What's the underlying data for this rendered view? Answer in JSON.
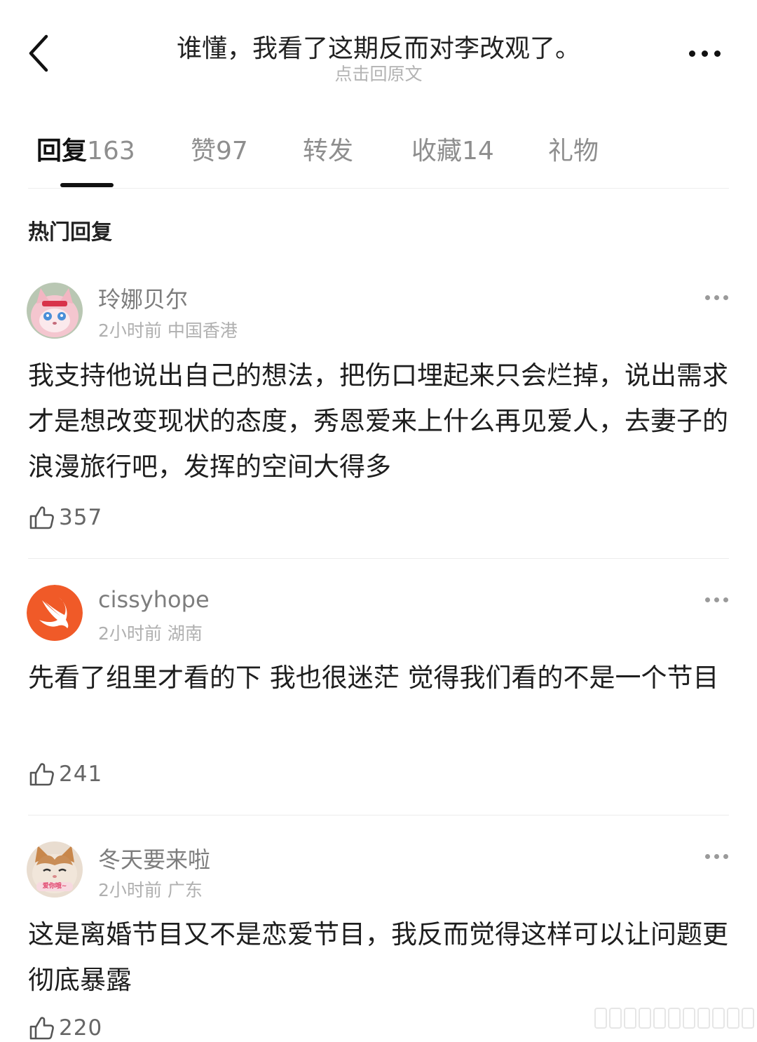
{
  "header": {
    "title": "谁懂，我看了这期反而对李改观了。",
    "subtitle": "点击回原文"
  },
  "tabs": [
    {
      "label": "回复",
      "count": "163",
      "active": true
    },
    {
      "label": "赞",
      "count": "97",
      "active": false
    },
    {
      "label": "转发",
      "count": "",
      "active": false
    },
    {
      "label": "收藏",
      "count": "14",
      "active": false
    },
    {
      "label": "礼物",
      "count": "",
      "active": false
    }
  ],
  "section_title": "热门回复",
  "comments": [
    {
      "username": "玲娜贝尔",
      "time": "2小时前",
      "location": "中国香港",
      "text": "我支持他说出自己的想法，把伤口埋起来只会烂掉，说出需求才是想改变现状的态度，秀恩爱来上什么再见爱人，去妻子的浪漫旅行吧，发挥的空间大得多",
      "likes": "357",
      "avatar": "pink-fox-plush-avatar"
    },
    {
      "username": "cissyhope",
      "time": "2小时前",
      "location": "湖南",
      "text": "先看了组里才看的下 我也很迷茫 觉得我们看的不是一个节目",
      "likes": "241",
      "avatar": "swift-logo-avatar"
    },
    {
      "username": "冬天要来啦",
      "time": "2小时前",
      "location": "广东",
      "text": "这是离婚节目又不是恋爱节目，我反而觉得这样可以让问题更彻底暴露",
      "likes": "220",
      "avatar": "kitten-avatar",
      "avatar_caption": "爱你哦~"
    }
  ],
  "colors": {
    "text_primary": "#1e1e1e",
    "text_secondary": "#7d7d7d",
    "text_muted": "#b0b0b0",
    "swift_orange": "#f05a28"
  }
}
